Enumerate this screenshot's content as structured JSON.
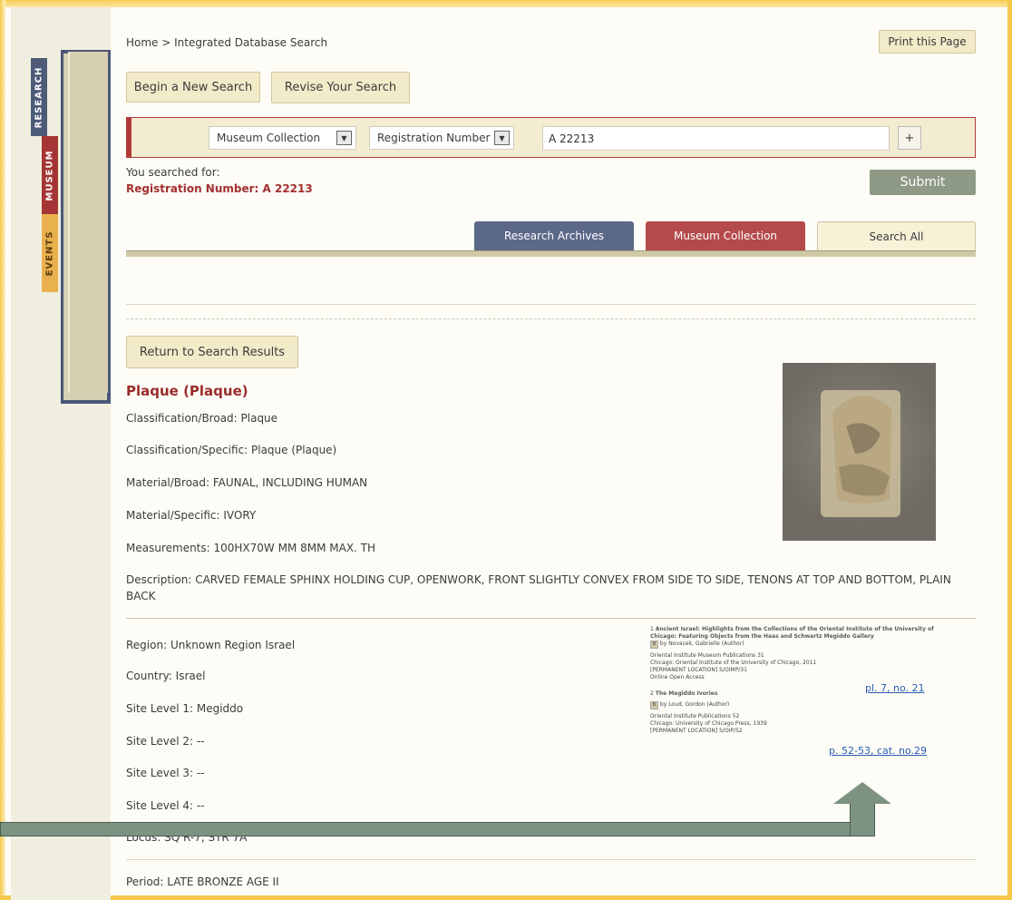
{
  "nav": {
    "breadcrumb": "Home > Integrated Database Search",
    "print_label": "Print this Page",
    "side_tabs": [
      "RESEARCH",
      "MUSEUM",
      "EVENTS"
    ]
  },
  "search": {
    "new_search_label": "Begin a New Search",
    "revise_label": "Revise Your Search",
    "source_select": "Museum Collection",
    "field_select": "Registration Number",
    "query": "A 22213",
    "plus_label": "+",
    "searched_for_label": "You searched for:",
    "searched_for_value": "Registration Number: A 22213",
    "submit_label": "Submit"
  },
  "tabs": [
    "Research Archives",
    "Museum Collection",
    "Search All"
  ],
  "record": {
    "return_label": "Return to Search Results",
    "title": "Plaque (Plaque)",
    "fields": [
      "Classification/Broad: Plaque",
      "Classification/Specific: Plaque (Plaque)",
      "Material/Broad: FAUNAL, INCLUDING HUMAN",
      "Material/Specific: IVORY",
      "Measurements: 100HX70W MM 8MM MAX. TH"
    ],
    "description": "Description: CARVED FEMALE SPHINX HOLDING CUP, OPENWORK, FRONT SLIGHTLY CONVEX FROM SIDE TO SIDE, TENONS AT TOP AND BOTTOM, PLAIN BACK",
    "location_fields": [
      "Region: Unknown Region Israel",
      "Country: Israel",
      "Site Level 1: Megiddo",
      "Site Level 2: --",
      "Site Level 3: --",
      "Site Level 4: --",
      "Locus: SQ R-7, STR 7A"
    ],
    "period": "Period: LATE BRONZE AGE II"
  },
  "references": [
    {
      "num": "1",
      "title": "Ancient Israel: Highlights from the Collections of the Oriental Institute of the University of Chicago: Featuring Objects from the Haas and Schwartz Megiddo Gallery",
      "author": "by Novacek, Gabrielle (Author)",
      "pub": "Oriental Institute Museum Publications 31",
      "pub2": "Chicago: Oriental Institute of the University of Chicago, 2011",
      "loc": "[PERMANENT LOCATION] S/OIMP/31",
      "access": "Online Open Access",
      "link": "pl. 7, no. 21"
    },
    {
      "num": "2",
      "title": "The Megiddo Ivories",
      "author": "by Loud, Gordon (Author)",
      "pub": "Oriental Institute Publications 52",
      "pub2": "Chicago: University of Chicago Press, 1939",
      "loc": "[PERMANENT LOCATION] S/OIP/52",
      "access": "",
      "link": "p. 52-53, cat. no.29"
    }
  ],
  "colors": {
    "accent_red": "#a33030",
    "research_blue": "#4d5a78",
    "museum_red": "#a53535",
    "events_orange": "#e9b14d"
  }
}
